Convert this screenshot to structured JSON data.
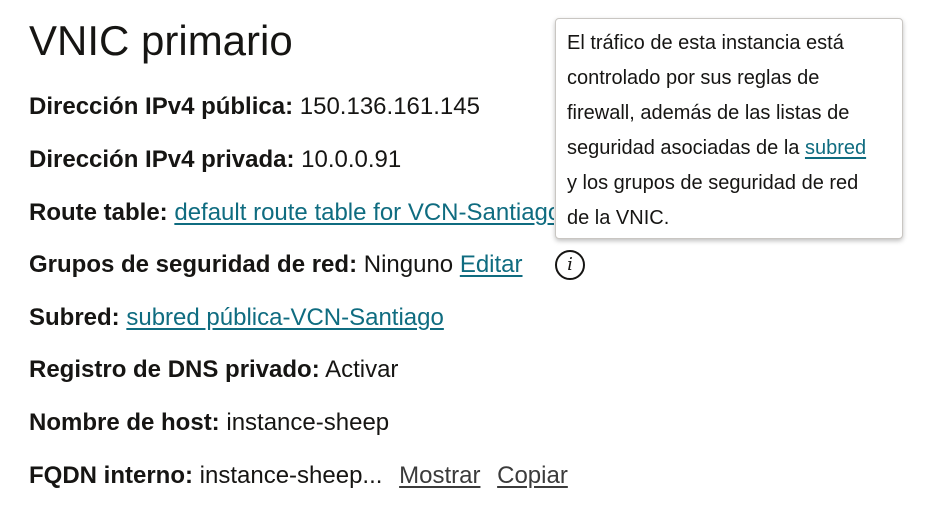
{
  "title": "VNIC primario",
  "fields": {
    "public_ip": {
      "label": "Dirección IPv4 pública:",
      "value": "150.136.161.145"
    },
    "private_ip": {
      "label": "Dirección IPv4 privada:",
      "value": "10.0.0.91"
    },
    "route_table": {
      "label": "Route table:",
      "link": "default route table for VCN-Santiago"
    },
    "nsg": {
      "label": "Grupos de seguridad de red:",
      "value": "Ninguno",
      "edit_link": "Editar"
    },
    "subnet": {
      "label": "Subred:",
      "link": "subred pública-VCN-Santiago"
    },
    "dns": {
      "label": "Registro de DNS privado:",
      "value": "Activar"
    },
    "hostname": {
      "label": "Nombre de host:",
      "value": "instance-sheep"
    },
    "fqdn": {
      "label": "FQDN interno:",
      "value": "instance-sheep...",
      "show_link": "Mostrar",
      "copy_link": "Copiar"
    }
  },
  "info_icon": {
    "glyph": "i",
    "icon": "info-circle-icon"
  },
  "tooltip": {
    "line1": "El tráfico de esta instancia está",
    "line2": "controlado por sus reglas de",
    "line3": "firewall, además de las listas de",
    "line4_prefix": "seguridad asociadas de la",
    "line4_link": "subred",
    "line5": "y los grupos de seguridad de red",
    "line6": "de la VNIC."
  }
}
